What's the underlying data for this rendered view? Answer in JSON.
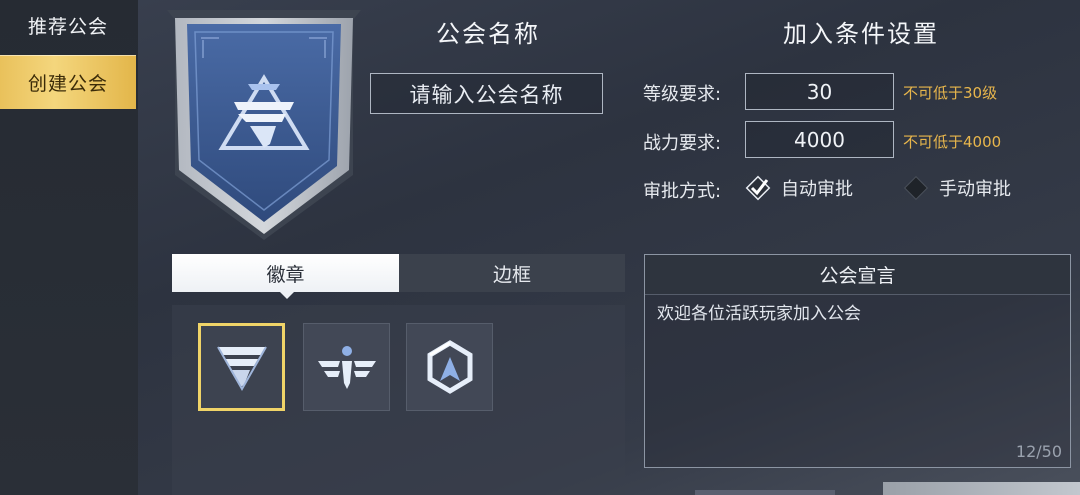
{
  "sidebar": {
    "items": [
      {
        "label": "推荐公会",
        "active": false
      },
      {
        "label": "创建公会",
        "active": true
      }
    ]
  },
  "guild_name": {
    "title": "公会名称",
    "placeholder": "请输入公会名称"
  },
  "join_conditions": {
    "title": "加入条件设置",
    "level": {
      "label": "等级要求:",
      "value": "30",
      "hint": "不可低于30级"
    },
    "power": {
      "label": "战力要求:",
      "value": "4000",
      "hint": "不可低于4000"
    },
    "approval": {
      "label": "审批方式:",
      "options": [
        {
          "label": "自动审批",
          "selected": true
        },
        {
          "label": "手动审批",
          "selected": false
        }
      ]
    }
  },
  "tabs": [
    {
      "label": "徽章",
      "active": true
    },
    {
      "label": "边框",
      "active": false
    }
  ],
  "emblems": [
    {
      "icon": "emblem-f-triangle-icon",
      "selected": true
    },
    {
      "icon": "emblem-winged-figure-icon",
      "selected": false
    },
    {
      "icon": "emblem-hexagon-arrow-icon",
      "selected": false
    }
  ],
  "declaration": {
    "title": "公会宣言",
    "text": "欢迎各位活跃玩家加入公会",
    "count": "12/50"
  },
  "colors": {
    "accent_gold": "#e9c15b",
    "hint_text": "#e8b64c",
    "selected_border": "#f0d468",
    "banner_blue": "#3e5d98"
  }
}
